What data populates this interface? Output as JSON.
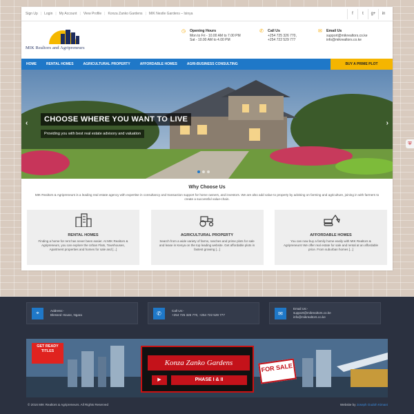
{
  "topbar": {
    "links": [
      "Sign Up",
      "Login",
      "My Account",
      "View Profile",
      "Konza Zanko Gardens",
      "MIK Nestle Gardens – Isinya"
    ],
    "social": [
      "f",
      "t",
      "g+",
      "in"
    ]
  },
  "header": {
    "logo_text": "MIK Realtors and Agripreneurs",
    "hours": {
      "title": "Opening Hours",
      "line1": "Mon to Fri - 10.00 AM to 7.00 PM",
      "line2": "Sat - 10.00 AM to 4.00 PM"
    },
    "call": {
      "title": "Call Us",
      "line1": "+254 725 326 770,",
      "line2": "+254 722 529 777"
    },
    "email": {
      "title": "Email Us",
      "line1": "support@mikrealtors.co.ke",
      "line2": "info@mikrealtors.co.ke"
    }
  },
  "nav": {
    "items": [
      "Home",
      "Rental Homes",
      "Agricultural Property",
      "Affordable Homes",
      "Agri-Business Consulting"
    ],
    "cta": "BUY A PRIME PLOT"
  },
  "hero": {
    "headline": "CHOOSE WHERE YOU WANT TO LIVE",
    "subline": "Providing you with best real estate advisory and valuation",
    "prev": "‹",
    "next": "›"
  },
  "why": {
    "title": "Why Choose Us",
    "description": "MIK Realtors & Agripreneurs is a leading real estate agency with expertise in consultancy and transaction support for home owners, and investors. We are also add value to property by advising on farming and agriculture, joining in with farmers to create a successful value-chain."
  },
  "cards": [
    {
      "icon": "building-icon",
      "title": "RENTAL HOMES",
      "text": "Finding a home for rent has never been easier. At MIK Realtors & Agripreneurs, you can explore the Urban Flats, Townhouses, Apartment properties and homes for sale and [...]"
    },
    {
      "icon": "tractor-icon",
      "title": "AGRICULTURAL PROPERTY",
      "text": "Search from a wide variety of farms, ranches and prime plots for sale and lease in Kenya on the top leading website. Get affordable plots in fastest growing [...]"
    },
    {
      "icon": "excavator-icon",
      "title": "AFFORDABLE HOMES",
      "text": "You can now buy a family home easily with MIK Realtors & Agripreneurs! We offer real estate for sale and rental at an affordable price. From suburban homes [...]"
    }
  ],
  "footer": {
    "address": {
      "label": "Address:-",
      "value": "Blessed House, Ngara"
    },
    "phone": {
      "label": "Call Us:-",
      "value": "+254 725 326 770, +254 722 529 777"
    },
    "email": {
      "label": "Email Us:-",
      "line1": "support@mikrealtors.co.ke",
      "line2": "info@mikrealtors.co.ke"
    },
    "banner": {
      "ribbon": "GET READY TITLES",
      "name": "Konza Zanko Gardens",
      "phase": "PHASE I & II",
      "sale": "FOR SALE"
    },
    "copyright": "© 2016 MIK Realtors & Agripreneurs. All Rights Reserved",
    "credit_prefix": "Website by",
    "credit_name": "Joseph Gudoh Kimani"
  },
  "colors": {
    "nav_blue": "#1f78c8",
    "accent_yellow": "#f5b500",
    "footer_dark": "#2b3140",
    "sale_red": "#c4121a"
  }
}
